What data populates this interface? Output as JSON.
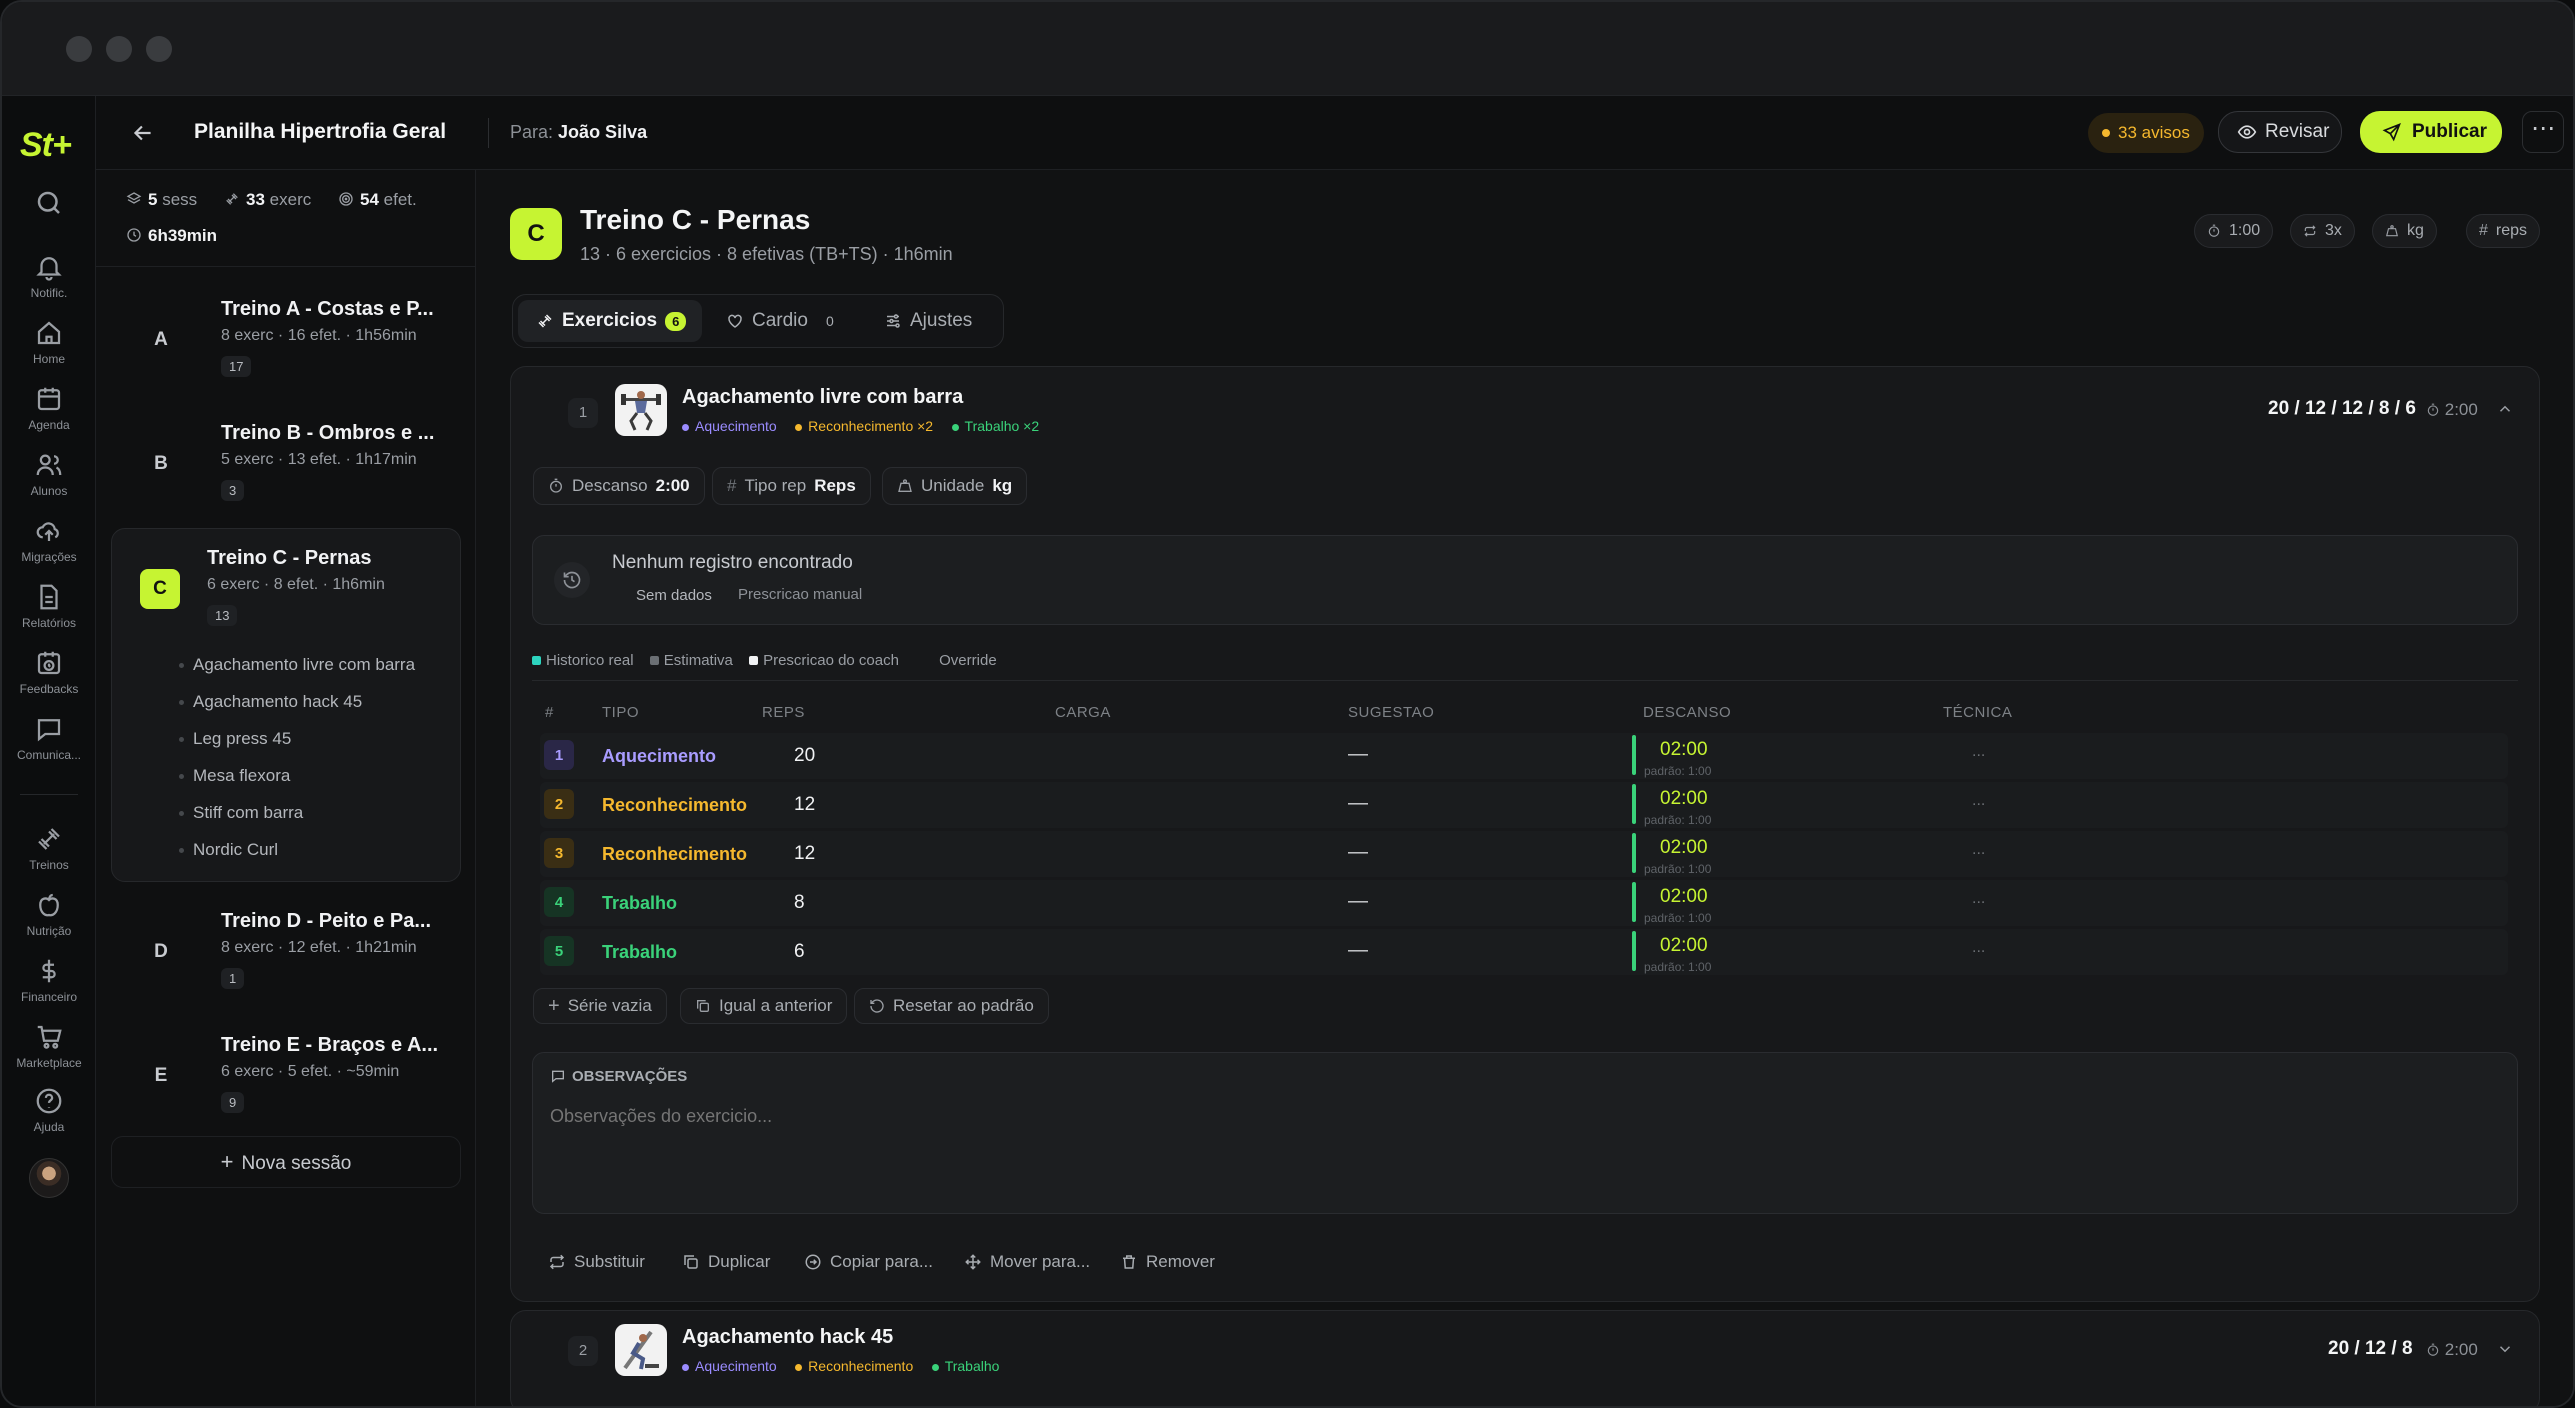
{
  "app": {
    "logo": "St+",
    "title": "Planilha Hipertrofia Geral",
    "for_label": "Para:",
    "for_name": "João Silva",
    "warnings": "33 avisos",
    "review": "Revisar",
    "publish": "Publicar"
  },
  "rail": [
    {
      "icon": "search-icon",
      "label": ""
    },
    {
      "icon": "bell-icon",
      "label": "Notific."
    },
    {
      "icon": "home-icon",
      "label": "Home"
    },
    {
      "icon": "calendar-icon",
      "label": "Agenda"
    },
    {
      "icon": "users-icon",
      "label": "Alunos"
    },
    {
      "icon": "cloud-upload-icon",
      "label": "Migrações"
    },
    {
      "icon": "file-icon",
      "label": "Relatórios"
    },
    {
      "icon": "clock-calendar-icon",
      "label": "Feedbacks"
    },
    {
      "icon": "message-icon",
      "label": "Comunica..."
    },
    {
      "icon": "dumbbell-icon",
      "label": "Treinos"
    },
    {
      "icon": "apple-icon",
      "label": "Nutrição"
    },
    {
      "icon": "dollar-icon",
      "label": "Financeiro"
    },
    {
      "icon": "cart-icon",
      "label": "Marketplace"
    },
    {
      "icon": "help-icon",
      "label": "Ajuda"
    }
  ],
  "stats": {
    "sess_num": "5",
    "sess_lbl": "sess",
    "exerc_num": "33",
    "exerc_lbl": "exerc",
    "efet_num": "54",
    "efet_lbl": "efet.",
    "time": "6h39min"
  },
  "sessions": [
    {
      "letter": "A",
      "title": "Treino A - Costas e P...",
      "sub": "8 exerc · 16 efet. · 1h56min",
      "count": "17"
    },
    {
      "letter": "B",
      "title": "Treino B - Ombros e ...",
      "sub": "5 exerc · 13 efet. · 1h17min",
      "count": "3"
    },
    {
      "letter": "C",
      "title": "Treino C - Pernas",
      "sub": "6 exerc · 8 efet. · 1h6min",
      "count": "13",
      "exercises": [
        "Agachamento livre com barra",
        "Agachamento hack 45",
        "Leg press 45",
        "Mesa flexora",
        "Stiff com barra",
        "Nordic Curl"
      ]
    },
    {
      "letter": "D",
      "title": "Treino D - Peito e Pa...",
      "sub": "8 exerc · 12 efet. · 1h21min",
      "count": "1"
    },
    {
      "letter": "E",
      "title": "Treino E - Braços e A...",
      "sub": "6 exerc · 5 efet. · ~59min",
      "count": "9"
    }
  ],
  "new_session": "Nova sessão",
  "workout": {
    "letter": "C",
    "title": "Treino C - Pernas",
    "sub": "13 · 6 exercicios · 8 efetivas (TB+TS) · 1h6min",
    "defaults": [
      "1:00",
      "3x",
      "kg",
      "reps"
    ],
    "tabs": [
      {
        "label": "Exercicios",
        "count": "6"
      },
      {
        "label": "Cardio",
        "count": "0"
      },
      {
        "label": "Ajustes",
        "count": ""
      }
    ]
  },
  "exercise1": {
    "num": "1",
    "name": "Agachamento livre com barra",
    "tags": [
      {
        "label": "Aquecimento",
        "color": "#9b8cff"
      },
      {
        "label": "Reconhecimento ×2",
        "color": "#f5b82e"
      },
      {
        "label": "Trabalho ×2",
        "color": "#3ad27a"
      }
    ],
    "summary": "20 / 12 / 12 / 8 / 6",
    "rest": "2:00",
    "chips": [
      {
        "label": "Descanso",
        "value": "2:00"
      },
      {
        "label": "Tipo rep",
        "value": "Reps"
      },
      {
        "label": "Unidade",
        "value": "kg"
      }
    ],
    "history_title": "Nenhum registro encontrado",
    "history_no_data": "Sem dados",
    "history_manual": "Prescricao manual",
    "legend": [
      "Historico real",
      "Estimativa",
      "Prescricao do coach",
      "Override"
    ],
    "columns": [
      "#",
      "TIPO",
      "REPS",
      "CARGA",
      "SUGESTAO",
      "DESCANSO",
      "TÉCNICA"
    ],
    "sets": [
      {
        "n": "1",
        "type": "Aquecimento",
        "reps": "20",
        "sug": "—",
        "rest": "02:00",
        "default": "padrão: 1:00",
        "tech": "..."
      },
      {
        "n": "2",
        "type": "Reconhecimento",
        "reps": "12",
        "sug": "—",
        "rest": "02:00",
        "default": "padrão: 1:00",
        "tech": "..."
      },
      {
        "n": "3",
        "type": "Reconhecimento",
        "reps": "12",
        "sug": "—",
        "rest": "02:00",
        "default": "padrão: 1:00",
        "tech": "..."
      },
      {
        "n": "4",
        "type": "Trabalho",
        "reps": "8",
        "sug": "—",
        "rest": "02:00",
        "default": "padrão: 1:00",
        "tech": "..."
      },
      {
        "n": "5",
        "type": "Trabalho",
        "reps": "6",
        "sug": "—",
        "rest": "02:00",
        "default": "padrão: 1:00",
        "tech": "..."
      }
    ],
    "set_actions": [
      "Série vazia",
      "Igual a anterior",
      "Resetar ao padrão"
    ],
    "notes_label": "OBSERVAÇÕES",
    "notes_placeholder": "Observações do exercicio...",
    "footer_actions": [
      "Substituir",
      "Duplicar",
      "Copiar para...",
      "Mover para...",
      "Remover"
    ]
  },
  "exercise2": {
    "num": "2",
    "name": "Agachamento hack 45",
    "tags": [
      {
        "label": "Aquecimento",
        "color": "#9b8cff"
      },
      {
        "label": "Reconhecimento",
        "color": "#f5b82e"
      },
      {
        "label": "Trabalho",
        "color": "#3ad27a"
      }
    ],
    "summary": "20 / 12 / 8",
    "rest": "2:00"
  }
}
